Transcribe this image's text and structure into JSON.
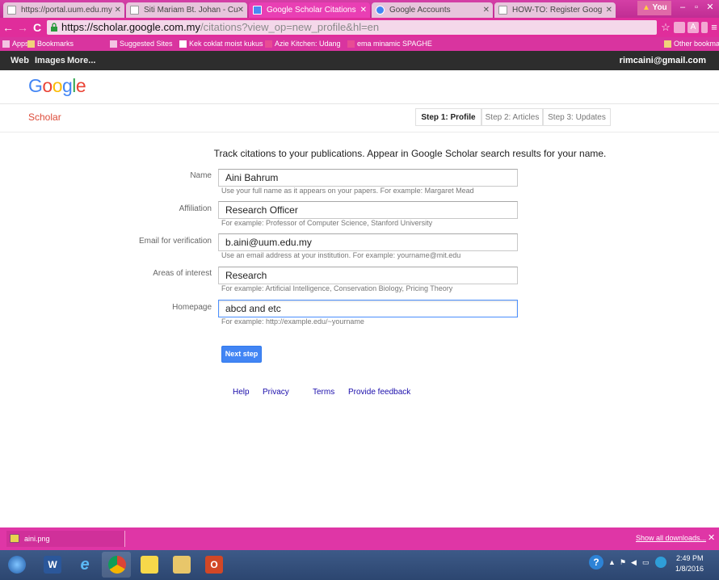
{
  "browser": {
    "tabs": [
      {
        "label": "https://portal.uum.edu.my",
        "active": false
      },
      {
        "label": "Siti Mariam Bt. Johan - Cu",
        "active": false
      },
      {
        "label": "Google Scholar Citations",
        "active": true
      },
      {
        "label": "Google Accounts",
        "active": false
      },
      {
        "label": "HOW-TO: Register Goog",
        "active": false
      }
    ],
    "profile_label": "You",
    "url": {
      "host": "https://scholar.google.com.my",
      "path": "/citations?view_op=new_profile&hl=en"
    },
    "bookmarks": [
      {
        "label": "Apps"
      },
      {
        "label": "Bookmarks"
      },
      {
        "label": "Suggested Sites"
      },
      {
        "label": "Kek coklat moist kukus"
      },
      {
        "label": "Azie Kitchen: Udang"
      },
      {
        "label": "ema minamic SPAGHE"
      }
    ],
    "other_bookmarks": "Other bookmarks",
    "accent_color": "#e02d9b"
  },
  "gbar": {
    "links": [
      "Web",
      "Images",
      "More..."
    ],
    "email": "rimcaini@gmail.com"
  },
  "logo_text": "Google",
  "scholar_label": "Scholar",
  "steps": [
    {
      "label": "Step 1: Profile",
      "current": true
    },
    {
      "label": "Step 2: Articles",
      "current": false
    },
    {
      "label": "Step 3: Updates",
      "current": false
    }
  ],
  "intro": "Track citations to your publications. Appear in Google Scholar search results for your name.",
  "form": {
    "name": {
      "label": "Name",
      "value": "Aini Bahrum",
      "hint": "Use your full name as it appears on your papers. For example: Margaret Mead"
    },
    "affiliation": {
      "label": "Affiliation",
      "value": "Research Officer",
      "hint": "For example: Professor of Computer Science, Stanford University"
    },
    "email": {
      "label": "Email for verification",
      "value": "b.aini@uum.edu.my",
      "hint": "Use an email address at your institution. For example: yourname@mit.edu"
    },
    "interests": {
      "label": "Areas of interest",
      "value": "Research",
      "hint": "For example: Artificial Intelligence, Conservation Biology, Pricing Theory"
    },
    "homepage": {
      "label": "Homepage",
      "value": "abcd and etc",
      "hint": "For example: http://example.edu/~yourname"
    },
    "next_label": "Next step"
  },
  "footer": [
    "Help",
    "Privacy",
    "Terms",
    "Provide feedback"
  ],
  "downloads": {
    "file": "aini.png",
    "show_all": "Show all downloads..."
  },
  "taskbar": {
    "time": "2:49 PM",
    "date": "1/8/2016"
  }
}
